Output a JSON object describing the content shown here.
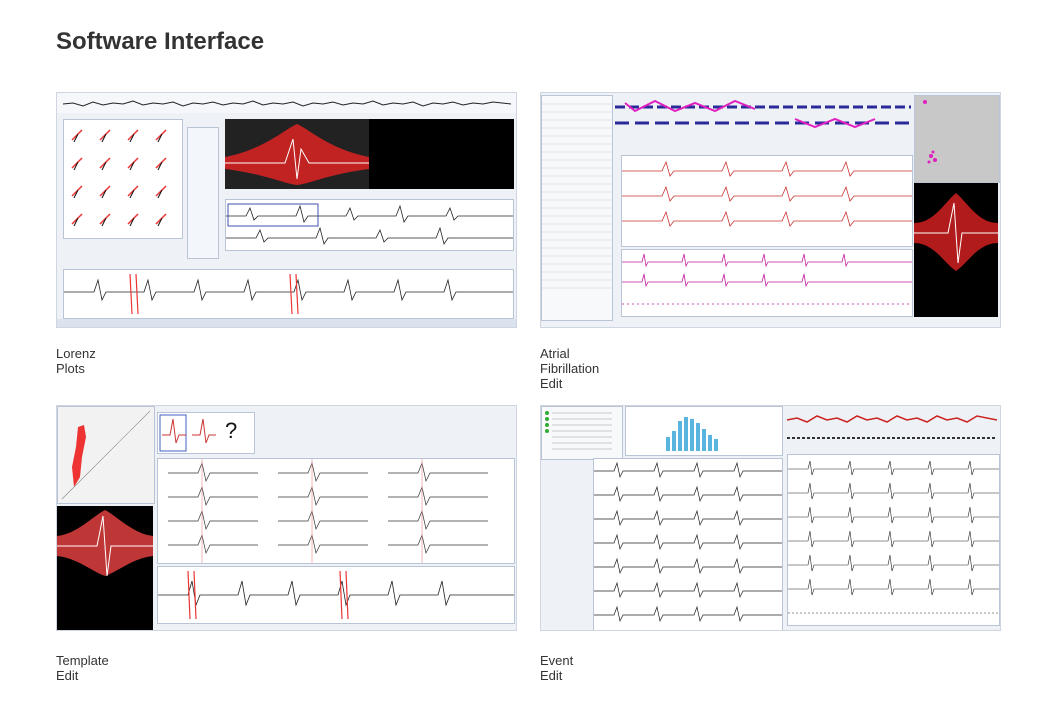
{
  "section_title": "Software Interface",
  "cards": [
    {
      "caption": "Lorenz Plots"
    },
    {
      "caption": "Atrial Fibrillation Edit"
    },
    {
      "caption": "Template Edit"
    },
    {
      "caption": "Event Edit"
    }
  ],
  "template_edit": {
    "unknown_symbol": "?"
  }
}
